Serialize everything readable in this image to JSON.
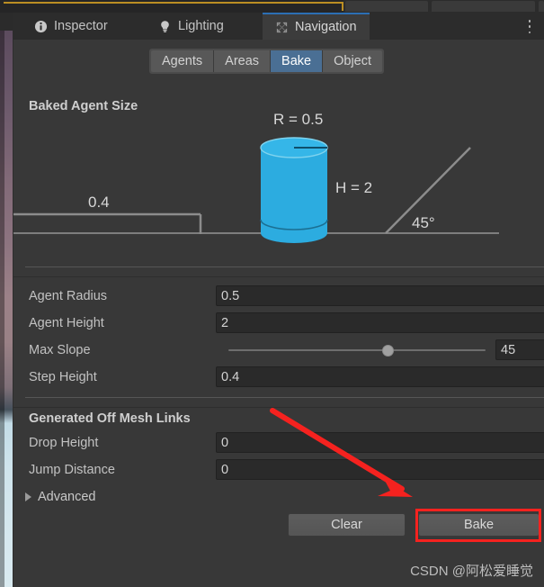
{
  "window": {
    "tabs": [
      {
        "label": "Inspector",
        "icon": "info-icon",
        "active": false
      },
      {
        "label": "Lighting",
        "icon": "lightbulb-icon",
        "active": false
      },
      {
        "label": "Navigation",
        "icon": "move-arrows-icon",
        "active": true
      }
    ],
    "menu_icon": "kebab-menu-icon"
  },
  "toolbar": {
    "segments": [
      {
        "label": "Agents",
        "active": false
      },
      {
        "label": "Areas",
        "active": false
      },
      {
        "label": "Bake",
        "active": true
      },
      {
        "label": "Object",
        "active": false
      }
    ]
  },
  "sections": {
    "baked_agent_size": {
      "title": "Baked Agent Size",
      "diagram": {
        "radius_label": "R = 0.5",
        "height_label": "H = 2",
        "step_label": "0.4",
        "slope_label": "45°",
        "cylinder_color": "#2CACE0",
        "line_color": "#8c8c8c"
      },
      "fields": [
        {
          "label": "Agent Radius",
          "value": "0.5",
          "type": "number"
        },
        {
          "label": "Agent Height",
          "value": "2",
          "type": "number"
        },
        {
          "label": "Max Slope",
          "value": "45",
          "type": "slider",
          "min": 0,
          "max": 60,
          "percent": 62
        },
        {
          "label": "Step Height",
          "value": "0.4",
          "type": "number"
        }
      ]
    },
    "generated_off_mesh_links": {
      "title": "Generated Off Mesh Links",
      "fields": [
        {
          "label": "Drop Height",
          "value": "0",
          "type": "number"
        },
        {
          "label": "Jump Distance",
          "value": "0",
          "type": "number"
        }
      ]
    },
    "advanced": {
      "label": "Advanced",
      "expanded": false,
      "icon": "triangle-right-icon"
    }
  },
  "actions": {
    "clear_label": "Clear",
    "bake_label": "Bake"
  },
  "annotation": {
    "color": "#F5221F",
    "highlight_target": "bake-button",
    "arrow_icon": "red-arrow-icon"
  },
  "watermark": {
    "text": "CSDN @阿松爱睡觉"
  }
}
